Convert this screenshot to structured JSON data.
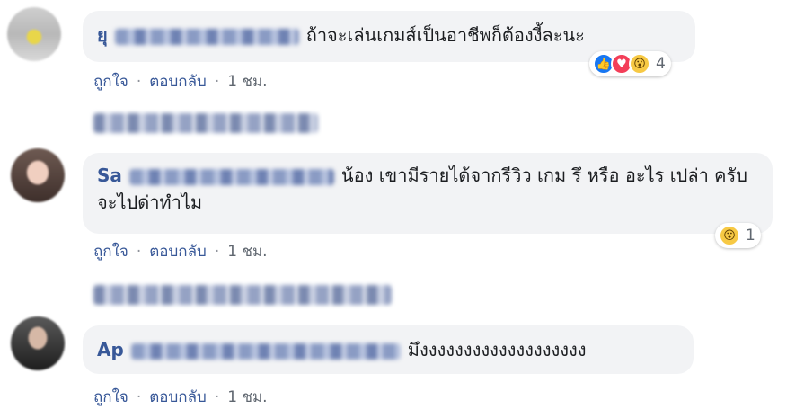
{
  "comments": [
    {
      "text": "ถ้าจะเล่นเกมส์เป็นอาชีพก็ต้องงี้ละนะ",
      "author_prefix": "ยุ",
      "reactions": {
        "types": [
          "like",
          "love",
          "wow"
        ],
        "count": "4"
      },
      "actions": {
        "like": "ถูกใจ",
        "reply": "ตอบกลับ",
        "time": "1 ชม."
      }
    },
    {
      "text": "น้อง เขามีรายได้จากรีวิว เกม รึ หรือ อะไร เปล่า ครับ จะไปด่าทำไม",
      "author_prefix": "Sa",
      "reactions": {
        "types": [
          "wow"
        ],
        "count": "1"
      },
      "actions": {
        "like": "ถูกใจ",
        "reply": "ตอบกลับ",
        "time": "1 ชม."
      }
    },
    {
      "text": "มึงงงงงงงงงงงงงงงงงงง",
      "author_prefix": "Ap",
      "actions": {
        "like": "ถูกใจ",
        "reply": "ตอบกลับ",
        "time": "1 ชม."
      }
    }
  ],
  "separator": "·",
  "icons": {
    "like": "thumbs-up-icon",
    "love": "heart-icon",
    "wow": "wow-face-icon"
  },
  "colors": {
    "author": "#385898",
    "bubble": "#f2f3f5",
    "like": "#1877f2",
    "love": "#f33e58",
    "wow": "#f7c944"
  }
}
